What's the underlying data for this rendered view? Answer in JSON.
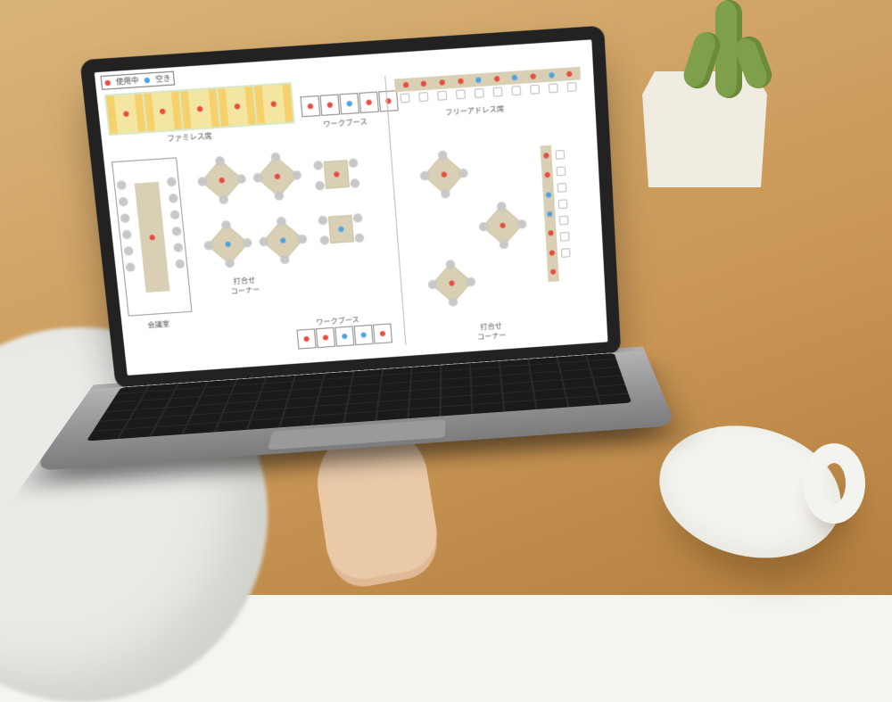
{
  "legend": {
    "occupied": "使用中",
    "vacant": "空き"
  },
  "colors": {
    "occupied": "#e84c3d",
    "vacant": "#4da3e0"
  },
  "sections": {
    "famires": {
      "label": "ファミレス席",
      "booths": [
        "occupied",
        "occupied",
        "occupied",
        "occupied",
        "occupied"
      ]
    },
    "workbooth_top": {
      "label": "ワークブース",
      "seats": [
        "occupied",
        "occupied",
        "vacant",
        "occupied",
        "occupied"
      ]
    },
    "free_address": {
      "label": "フリーアドレス席",
      "seats": [
        "occupied",
        "occupied",
        "occupied",
        "occupied",
        "vacant",
        "occupied",
        "vacant",
        "occupied",
        "vacant",
        "occupied"
      ]
    },
    "meeting_room": {
      "label": "会議室",
      "status": "occupied",
      "chairs_per_side": 6
    },
    "meeting_corner_left": {
      "label": "打合せ\nコーナー",
      "tables": [
        {
          "status": "occupied"
        },
        {
          "status": "occupied"
        },
        {
          "status": "vacant"
        },
        {
          "status": "vacant"
        }
      ],
      "rect_tables": [
        {
          "status": "occupied"
        },
        {
          "status": "vacant"
        }
      ]
    },
    "workbooth_bottom": {
      "label": "ワークブース",
      "seats": [
        "occupied",
        "occupied",
        "vacant",
        "vacant",
        "occupied"
      ]
    },
    "right_cluster": {
      "tables": [
        {
          "status": "occupied"
        },
        {
          "status": "occupied"
        },
        {
          "status": "occupied"
        }
      ],
      "counter": [
        "occupied",
        "occupied",
        "vacant",
        "vacant",
        "occupied",
        "occupied",
        "occupied"
      ],
      "label": "打合せ\nコーナー"
    }
  }
}
